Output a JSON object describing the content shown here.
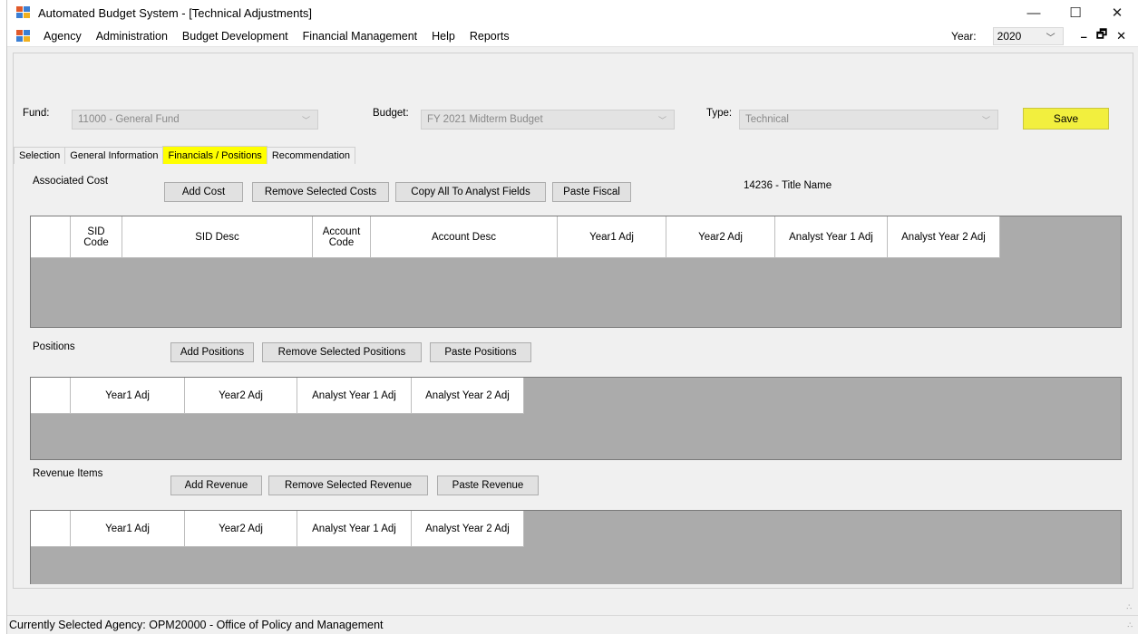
{
  "window": {
    "title": "Automated Budget System - [Technical Adjustments]",
    "controls": {
      "minimize": "—",
      "maximize": "☐",
      "close": "✕"
    }
  },
  "menu": {
    "items": [
      "Agency",
      "Administration",
      "Budget Development",
      "Financial Management",
      "Help",
      "Reports"
    ],
    "year_label": "Year:",
    "year_value": "2020",
    "mdi_controls": {
      "minimize": "–",
      "restore": "🗗",
      "close": "✕"
    }
  },
  "filters": {
    "fund_label": "Fund:",
    "fund_value": "11000 - General Fund",
    "budget_label": "Budget:",
    "budget_value": "FY 2021 Midterm Budget",
    "type_label": "Type:",
    "type_value": "Technical",
    "save_label": "Save"
  },
  "tabs": [
    {
      "label": "Selection",
      "active": false
    },
    {
      "label": "General Information",
      "active": false
    },
    {
      "label": "Financials / Positions",
      "active": true
    },
    {
      "label": "Recommendation",
      "active": false
    }
  ],
  "associated_cost": {
    "label": "Associated Cost",
    "buttons": [
      "Add Cost",
      "Remove Selected Costs",
      "Copy All To Analyst Fields",
      "Paste Fiscal"
    ],
    "title_name": "14236 - Title Name",
    "columns": [
      "SID Code",
      "SID Desc",
      "Account Code",
      "Account Desc",
      "Year1 Adj",
      "Year2 Adj",
      "Analyst Year 1 Adj",
      "Analyst Year 2 Adj"
    ]
  },
  "positions": {
    "label": "Positions",
    "buttons": [
      "Add Positions",
      "Remove Selected Positions",
      "Paste Positions"
    ],
    "columns": [
      "Year1 Adj",
      "Year2 Adj",
      "Analyst Year 1 Adj",
      "Analyst Year 2 Adj"
    ]
  },
  "revenue": {
    "label": "Revenue Items",
    "buttons": [
      "Add Revenue",
      "Remove Selected Revenue",
      "Paste Revenue"
    ],
    "columns": [
      "Year1 Adj",
      "Year2 Adj",
      "Analyst Year 1 Adj",
      "Analyst Year 2 Adj"
    ]
  },
  "status": {
    "text": "Currently Selected Agency: OPM20000 - Office of Policy and Management"
  },
  "colors": {
    "highlight": "#ffff00",
    "save_button": "#f2ef3e",
    "grid_background": "#ababab"
  }
}
